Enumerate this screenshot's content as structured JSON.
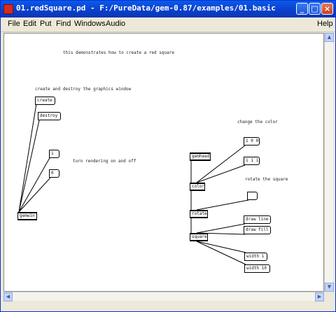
{
  "window": {
    "title": "01.redSquare.pd  - F:/PureData/gem-0.87/examples/01.basic"
  },
  "menu": [
    "File",
    "Edit",
    "Put",
    "Find",
    "Windows",
    "Audio",
    "Help"
  ],
  "patch": {
    "comments": [
      "this demonstrates how to create a red square",
      "create and destroy the graphics window",
      "turn rendering on and off",
      "change the color",
      "rotate the square"
    ],
    "objects": {
      "create": "create",
      "destroy": "destroy",
      "toggle_on": "1",
      "toggle_off": "0",
      "gemwin": "gemwin",
      "gemhead": "gemhead",
      "color": "color",
      "rotate": "rotate",
      "square": "square",
      "color_red": "1 0 0",
      "color_white": "1 1 1",
      "rotate_value": "",
      "draw_line": "draw line",
      "draw_fill": "draw fill",
      "width_1": "width 1",
      "width_10": "width 10"
    }
  },
  "colors": {
    "titlebar": "#0a3fcb",
    "canvas": "#ffffff",
    "menubar": "#ece9d8"
  }
}
